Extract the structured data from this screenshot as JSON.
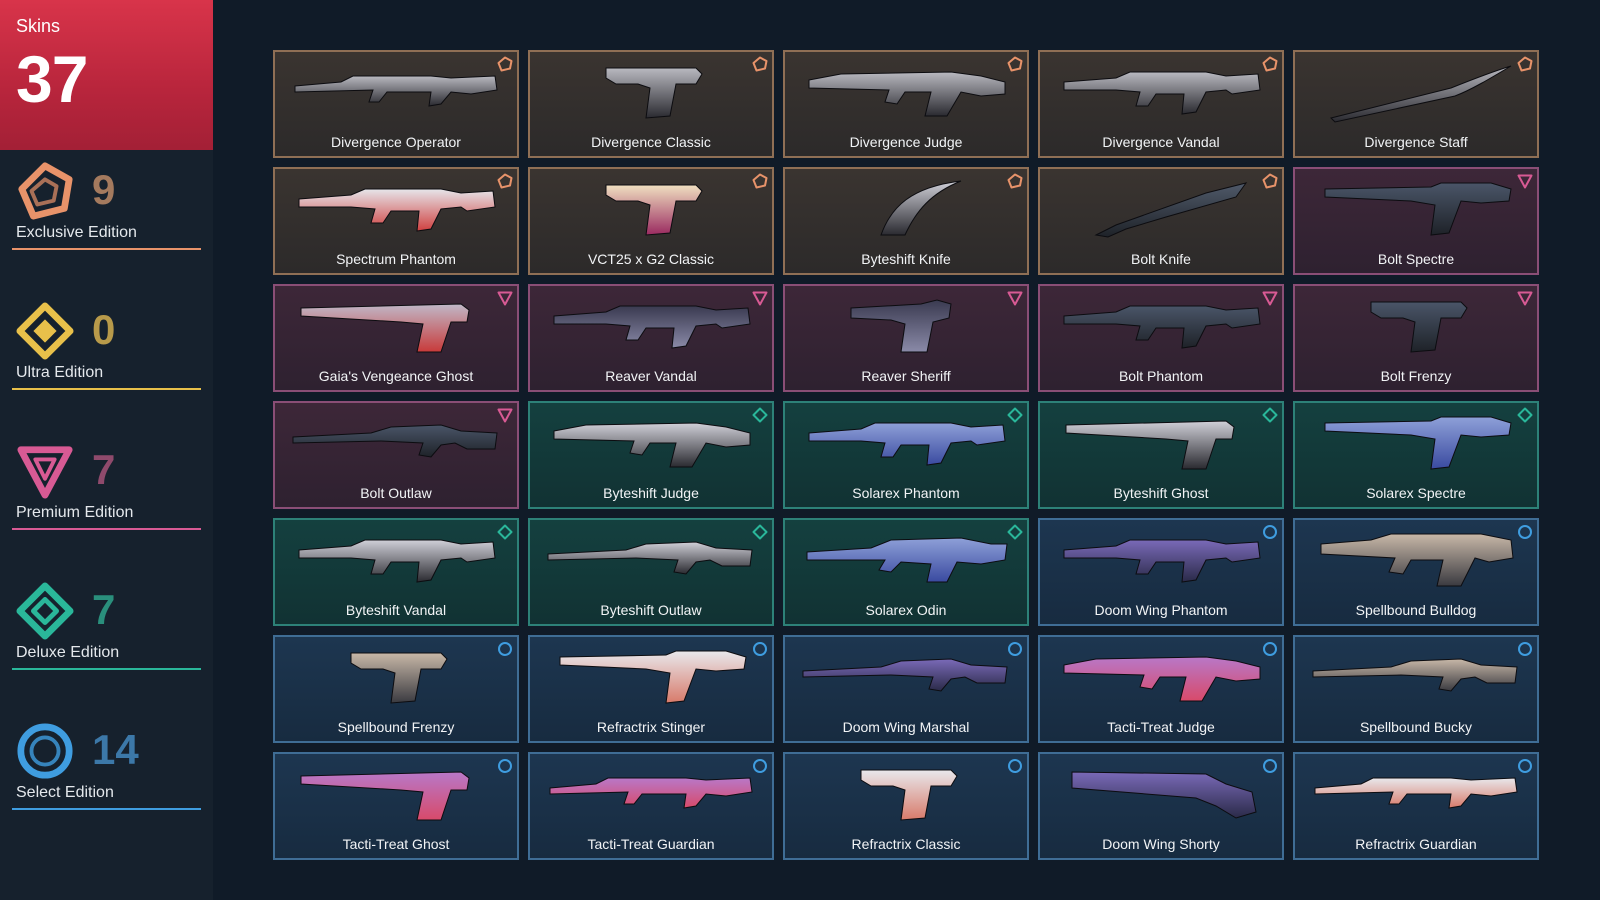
{
  "summary": {
    "label": "Skins",
    "total": "37"
  },
  "tiers": [
    {
      "key": "exclusive",
      "label": "Exclusive Edition",
      "count": "9",
      "color": "#e8936a",
      "count_color": "#a47a5e"
    },
    {
      "key": "ultra",
      "label": "Ultra Edition",
      "count": "0",
      "color": "#e8c04a",
      "count_color": "#b89a4a"
    },
    {
      "key": "premium",
      "label": "Premium Edition",
      "count": "7",
      "color": "#d85a94",
      "count_color": "#8f4a6c"
    },
    {
      "key": "deluxe",
      "label": "Deluxe Edition",
      "count": "7",
      "color": "#2ab79a",
      "count_color": "#2a8f7c"
    },
    {
      "key": "select",
      "label": "Select Edition",
      "count": "14",
      "color": "#3f9de0",
      "count_color": "#3c78a8"
    }
  ],
  "skins": [
    {
      "name": "Divergence Operator",
      "tier": "exclusive",
      "weapon": "rifle-long",
      "colors": [
        "#b9b9c0",
        "#2a2a30"
      ]
    },
    {
      "name": "Divergence Classic",
      "tier": "exclusive",
      "weapon": "pistol",
      "colors": [
        "#b9b9c0",
        "#2a2a30"
      ]
    },
    {
      "name": "Divergence Judge",
      "tier": "exclusive",
      "weapon": "shotgun",
      "colors": [
        "#b9b9c0",
        "#2a2a30"
      ]
    },
    {
      "name": "Divergence Vandal",
      "tier": "exclusive",
      "weapon": "rifle",
      "colors": [
        "#b9b9c0",
        "#2a2a30"
      ]
    },
    {
      "name": "Divergence Staff",
      "tier": "exclusive",
      "weapon": "staff",
      "colors": [
        "#b9b9c0",
        "#2a2a30"
      ]
    },
    {
      "name": "Spectrum Phantom",
      "tier": "exclusive",
      "weapon": "rifle",
      "colors": [
        "#e6e6ea",
        "#d04040"
      ]
    },
    {
      "name": "VCT25 x G2 Classic",
      "tier": "exclusive",
      "weapon": "pistol",
      "colors": [
        "#f0e0c0",
        "#9a2a60"
      ]
    },
    {
      "name": "Byteshift Knife",
      "tier": "exclusive",
      "weapon": "knife-curved",
      "colors": [
        "#d0d0d8",
        "#2a2a30"
      ]
    },
    {
      "name": "Bolt Knife",
      "tier": "exclusive",
      "weapon": "knife",
      "colors": [
        "#505a6a",
        "#1e2228"
      ]
    },
    {
      "name": "Bolt Spectre",
      "tier": "premium",
      "weapon": "smg",
      "colors": [
        "#4a5568",
        "#1e2228"
      ]
    },
    {
      "name": "Gaia's Vengeance Ghost",
      "tier": "premium",
      "weapon": "pistol-long",
      "colors": [
        "#c0b8c8",
        "#c83a3a"
      ]
    },
    {
      "name": "Reaver Vandal",
      "tier": "premium",
      "weapon": "rifle",
      "colors": [
        "#3a3a50",
        "#8a8aa8"
      ]
    },
    {
      "name": "Reaver Sheriff",
      "tier": "premium",
      "weapon": "revolver",
      "colors": [
        "#3a3a50",
        "#8a8aa8"
      ]
    },
    {
      "name": "Bolt Phantom",
      "tier": "premium",
      "weapon": "rifle",
      "colors": [
        "#4a5568",
        "#1e2228"
      ]
    },
    {
      "name": "Bolt Frenzy",
      "tier": "premium",
      "weapon": "pistol",
      "colors": [
        "#4a5568",
        "#1e2228"
      ]
    },
    {
      "name": "Bolt Outlaw",
      "tier": "premium",
      "weapon": "sniper",
      "colors": [
        "#4a5568",
        "#1e2228"
      ]
    },
    {
      "name": "Byteshift Judge",
      "tier": "deluxe",
      "weapon": "shotgun",
      "colors": [
        "#d0d0d8",
        "#2a2a30"
      ]
    },
    {
      "name": "Solarex Phantom",
      "tier": "deluxe",
      "weapon": "rifle",
      "colors": [
        "#8ea0d8",
        "#3a4aa0"
      ]
    },
    {
      "name": "Byteshift Ghost",
      "tier": "deluxe",
      "weapon": "pistol-long",
      "colors": [
        "#d0d0d8",
        "#2a2a30"
      ]
    },
    {
      "name": "Solarex Spectre",
      "tier": "deluxe",
      "weapon": "smg",
      "colors": [
        "#8ea0d8",
        "#3a4aa0"
      ]
    },
    {
      "name": "Byteshift Vandal",
      "tier": "deluxe",
      "weapon": "rifle",
      "colors": [
        "#d0d0d8",
        "#2a2a30"
      ]
    },
    {
      "name": "Byteshift Outlaw",
      "tier": "deluxe",
      "weapon": "sniper",
      "colors": [
        "#d0d0d8",
        "#2a2a30"
      ]
    },
    {
      "name": "Solarex Odin",
      "tier": "deluxe",
      "weapon": "lmg",
      "colors": [
        "#8ea0d8",
        "#3a4aa0"
      ]
    },
    {
      "name": "Doom Wing Phantom",
      "tier": "select",
      "weapon": "rifle",
      "colors": [
        "#7a6ab8",
        "#2a2a48"
      ]
    },
    {
      "name": "Spellbound Bulldog",
      "tier": "select",
      "weapon": "bulldog",
      "colors": [
        "#c8b8a8",
        "#3a3a40"
      ]
    },
    {
      "name": "Spellbound Frenzy",
      "tier": "select",
      "weapon": "pistol",
      "colors": [
        "#c8b8a8",
        "#3a3a40"
      ]
    },
    {
      "name": "Refractrix Stinger",
      "tier": "select",
      "weapon": "smg",
      "colors": [
        "#e8e8ec",
        "#d87a6a"
      ]
    },
    {
      "name": "Doom Wing Marshal",
      "tier": "select",
      "weapon": "sniper",
      "colors": [
        "#7a6ab8",
        "#2a2a48"
      ]
    },
    {
      "name": "Tacti-Treat Judge",
      "tier": "select",
      "weapon": "shotgun",
      "colors": [
        "#b878c8",
        "#d84a6a"
      ]
    },
    {
      "name": "Spellbound Bucky",
      "tier": "select",
      "weapon": "sniper",
      "colors": [
        "#c8b8a8",
        "#3a3a40"
      ]
    },
    {
      "name": "Tacti-Treat Ghost",
      "tier": "select",
      "weapon": "pistol-long",
      "colors": [
        "#b878c8",
        "#d84a6a"
      ]
    },
    {
      "name": "Tacti-Treat Guardian",
      "tier": "select",
      "weapon": "rifle-long",
      "colors": [
        "#b878c8",
        "#d84a6a"
      ]
    },
    {
      "name": "Refractrix Classic",
      "tier": "select",
      "weapon": "pistol",
      "colors": [
        "#e8e8ec",
        "#d87a6a"
      ]
    },
    {
      "name": "Doom Wing Shorty",
      "tier": "select",
      "weapon": "shorty",
      "colors": [
        "#7a6ab8",
        "#2a2a48"
      ]
    },
    {
      "name": "Refractrix Guardian",
      "tier": "select",
      "weapon": "rifle-long",
      "colors": [
        "#e8e8ec",
        "#d87a6a"
      ]
    }
  ]
}
